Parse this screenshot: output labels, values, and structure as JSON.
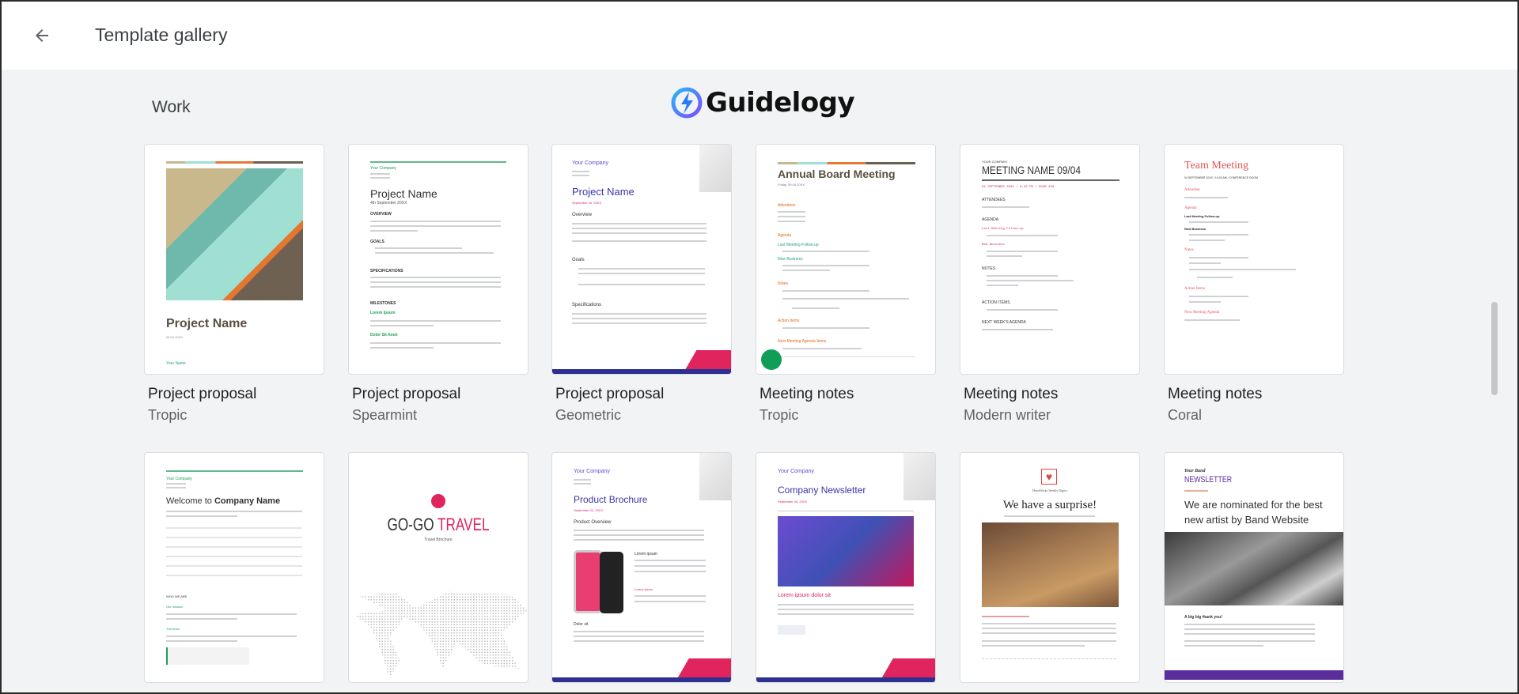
{
  "header": {
    "title": "Template gallery",
    "back_icon": "arrow-left-icon"
  },
  "section": {
    "title": "Work"
  },
  "watermark": {
    "text": "Guidelogy"
  },
  "colors": {
    "background": "#f1f3f4",
    "header": "#ffffff",
    "accent_green": "#0f9d58"
  },
  "cards": [
    {
      "name": "Project proposal",
      "theme": "Tropic",
      "thumb": {
        "heading": "Project Name",
        "date": "09.04.20XX",
        "name": "Your Name",
        "lines": [
          "Your Company",
          "123 Your Street",
          "Your City, ST 12345"
        ]
      }
    },
    {
      "name": "Project proposal",
      "theme": "Spearmint",
      "thumb": {
        "company": "Your Company",
        "heading": "Project Name",
        "date": "4th September 20XX",
        "sections": [
          "OVERVIEW",
          "GOALS",
          "SPECIFICATIONS",
          "MILESTONES"
        ],
        "sub": [
          "Lorem Ipsum",
          "Dolor Sit Amet"
        ]
      }
    },
    {
      "name": "Project proposal",
      "theme": "Geometric",
      "thumb": {
        "company": "Your Company",
        "heading": "Project Name",
        "date": "September 04, 20XX",
        "sections": [
          "Overview",
          "Goals",
          "Specifications"
        ]
      }
    },
    {
      "name": "Meeting notes",
      "theme": "Tropic",
      "thumb": {
        "heading": "Annual Board Meeting",
        "date": "Friday, 09.04.20XX",
        "sections": [
          "Attendees",
          "Agenda",
          "Notes",
          "Action Items",
          "Next Meeting Agenda Items"
        ],
        "sub": [
          "Last Meeting Follow-up",
          "New Business"
        ]
      }
    },
    {
      "name": "Meeting notes",
      "theme": "Modern writer",
      "thumb": {
        "company": "YOUR COMPANY",
        "heading": "MEETING NAME 09/04",
        "date": "04 SEPTEMBER 20XX / 6:30 PM / ROOM 436",
        "sections": [
          "ATTENDEES",
          "AGENDA",
          "NOTES",
          "ACTION ITEMS",
          "NEXT WEEK'S AGENDA"
        ],
        "sub": [
          "Last Meeting Follow-up",
          "New Business"
        ]
      }
    },
    {
      "name": "Meeting notes",
      "theme": "Coral",
      "thumb": {
        "heading": "Team Meeting",
        "date": "04 SEPTEMBER 20XX / 10:00 AM / CONFERENCE ROOM",
        "sections": [
          "Attendees",
          "Agenda",
          "Notes",
          "Action Items",
          "Next Meeting Agenda"
        ],
        "sub": [
          "Last Meeting Follow-up",
          "New Business"
        ]
      }
    },
    {
      "name": "",
      "theme": "",
      "thumb": {
        "company": "Your Company",
        "heading_pre": "Welcome to ",
        "heading": "Company Name",
        "sections": [
          "WHO WE ARE"
        ],
        "sub": [
          "Our mission",
          "The team"
        ]
      }
    },
    {
      "name": "",
      "theme": "",
      "thumb": {
        "heading_a": "GO-GO ",
        "heading": "TRAVEL",
        "sub": "Travel Brochure"
      }
    },
    {
      "name": "",
      "theme": "",
      "thumb": {
        "company": "Your Company",
        "heading": "Product Brochure",
        "date": "September 04, 20XX",
        "sections": [
          "Product Overview",
          "Dolor sit"
        ],
        "sub": [
          "Lorem ipsum",
          "Lorem ipsum"
        ]
      }
    },
    {
      "name": "",
      "theme": "",
      "thumb": {
        "company": "Your Company",
        "heading": "Company Newsletter",
        "date": "September 04, 20XX",
        "sub": "Lorem ipsum dolor sit"
      }
    },
    {
      "name": "",
      "theme": "",
      "thumb": {
        "brand": "HeartWorks Weekly Digest",
        "heading": "We have a surprise!"
      }
    },
    {
      "name": "",
      "theme": "",
      "thumb": {
        "band": "Your Band",
        "kicker": "NEWSLETTER",
        "heading": "We are nominated for the best new artist by Band Website",
        "sub": "A big big thank you!"
      }
    }
  ]
}
